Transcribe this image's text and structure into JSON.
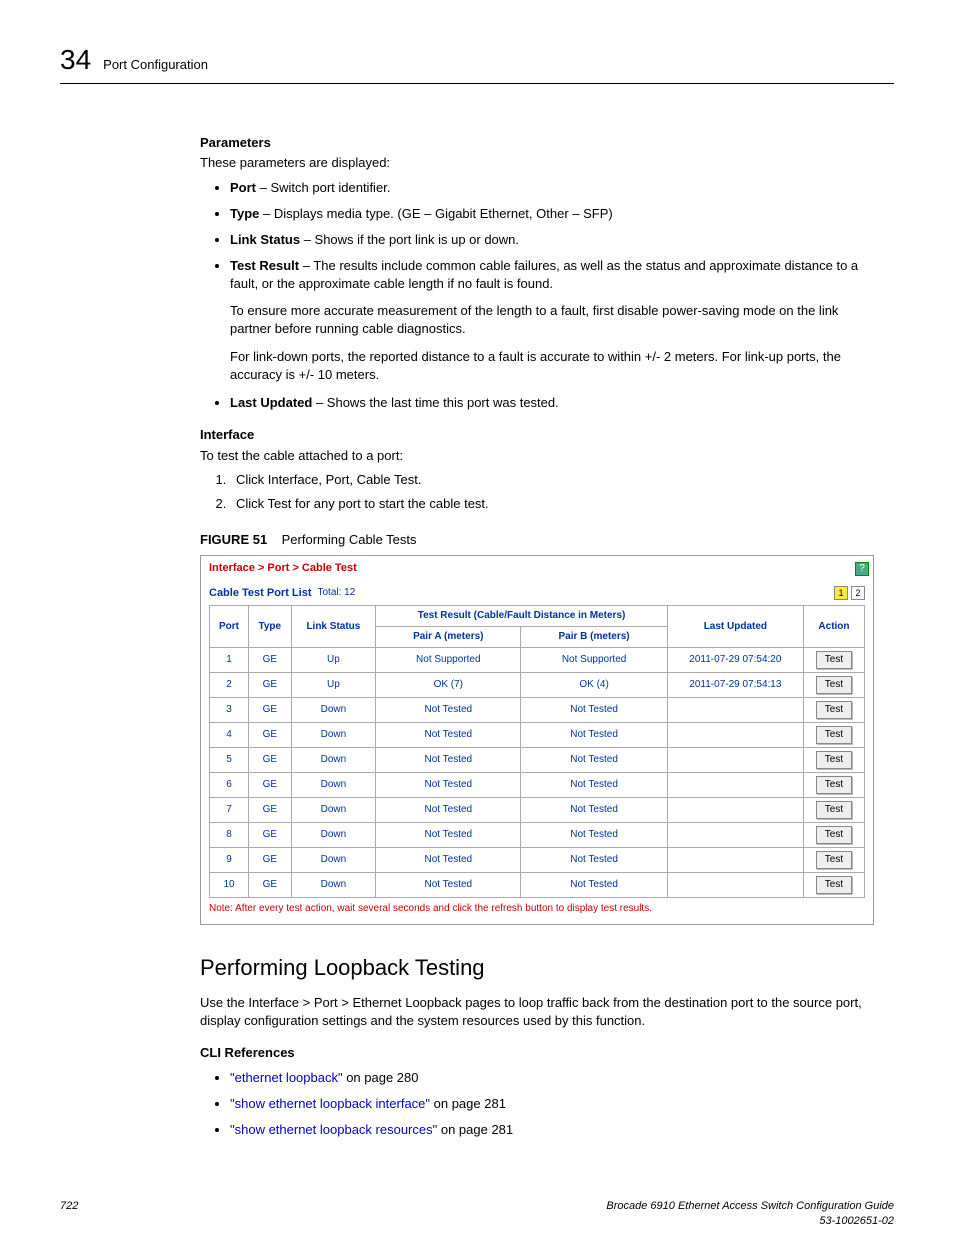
{
  "header": {
    "chapter_number": "34",
    "chapter_title": "Port Configuration"
  },
  "parameters": {
    "heading": "Parameters",
    "intro": "These parameters are displayed:",
    "items": [
      {
        "term": "Port",
        "desc": " – Switch port identifier."
      },
      {
        "term": "Type",
        "desc": " – Displays media type. (GE – Gigabit Ethernet, Other – SFP)"
      },
      {
        "term": "Link Status",
        "desc": " – Shows if the port link is up or down."
      },
      {
        "term": "Test Result",
        "desc": " – The results include common cable failures, as well as the status and approximate distance to a fault, or the approximate cable length if no fault is found."
      },
      {
        "term": "Last Updated",
        "desc": " – Shows the last time this port was tested."
      }
    ],
    "test_result_extra1": "To ensure more accurate measurement of the length to a fault, first disable power-saving mode on the link partner before running cable diagnostics.",
    "test_result_extra2": "For link-down ports, the reported distance to a fault is accurate to within +/- 2 meters. For link-up ports, the accuracy is +/- 10 meters."
  },
  "interface": {
    "heading": "Interface",
    "intro": "To test the cable attached to a port:",
    "steps": [
      "Click Interface, Port, Cable Test.",
      "Click Test for any port to start the cable test."
    ]
  },
  "figure": {
    "label": "FIGURE 51",
    "caption": "Performing Cable Tests"
  },
  "screenshot": {
    "breadcrumb": "Interface > Port > Cable Test",
    "list_title": "Cable Test Port List",
    "total_label": "Total: 12",
    "pager": [
      "1",
      "2"
    ],
    "columns": {
      "port": "Port",
      "type": "Type",
      "link_status": "Link Status",
      "test_result_group": "Test Result (Cable/Fault Distance in Meters)",
      "pair_a": "Pair A (meters)",
      "pair_b": "Pair B (meters)",
      "last_updated": "Last Updated",
      "action": "Action"
    },
    "action_label": "Test",
    "rows": [
      {
        "port": "1",
        "type": "GE",
        "link": "Up",
        "pairA": "Not Supported",
        "pairB": "Not Supported",
        "updated": "2011-07-29 07:54:20"
      },
      {
        "port": "2",
        "type": "GE",
        "link": "Up",
        "pairA": "OK (7)",
        "pairB": "OK (4)",
        "updated": "2011-07-29 07:54:13"
      },
      {
        "port": "3",
        "type": "GE",
        "link": "Down",
        "pairA": "Not Tested",
        "pairB": "Not Tested",
        "updated": ""
      },
      {
        "port": "4",
        "type": "GE",
        "link": "Down",
        "pairA": "Not Tested",
        "pairB": "Not Tested",
        "updated": ""
      },
      {
        "port": "5",
        "type": "GE",
        "link": "Down",
        "pairA": "Not Tested",
        "pairB": "Not Tested",
        "updated": ""
      },
      {
        "port": "6",
        "type": "GE",
        "link": "Down",
        "pairA": "Not Tested",
        "pairB": "Not Tested",
        "updated": ""
      },
      {
        "port": "7",
        "type": "GE",
        "link": "Down",
        "pairA": "Not Tested",
        "pairB": "Not Tested",
        "updated": ""
      },
      {
        "port": "8",
        "type": "GE",
        "link": "Down",
        "pairA": "Not Tested",
        "pairB": "Not Tested",
        "updated": ""
      },
      {
        "port": "9",
        "type": "GE",
        "link": "Down",
        "pairA": "Not Tested",
        "pairB": "Not Tested",
        "updated": ""
      },
      {
        "port": "10",
        "type": "GE",
        "link": "Down",
        "pairA": "Not Tested",
        "pairB": "Not Tested",
        "updated": ""
      }
    ],
    "note": "Note: After every test action, wait several seconds and click the refresh button to display test results."
  },
  "loopback": {
    "heading": "Performing Loopback Testing",
    "intro": "Use the Interface > Port > Ethernet Loopback pages to loop traffic back from the destination port to the source port, display configuration settings and the system resources used by this function.",
    "cli_heading": "CLI References",
    "refs": [
      {
        "link": "\"ethernet loopback\"",
        "suffix": " on page 280"
      },
      {
        "link": "\"show ethernet loopback interface\"",
        "suffix": " on page 281"
      },
      {
        "link": "\"show ethernet loopback resources\"",
        "suffix": " on page 281"
      }
    ]
  },
  "footer": {
    "page_number": "722",
    "doc_title": "Brocade 6910 Ethernet Access Switch Configuration Guide",
    "doc_id": "53-1002651-02"
  }
}
